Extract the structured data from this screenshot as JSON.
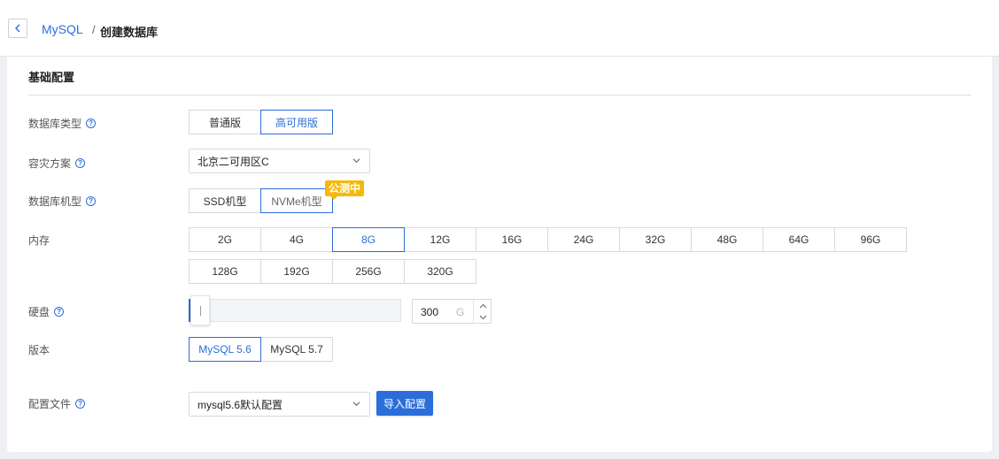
{
  "header": {
    "back_icon": "chevron-left-icon",
    "breadcrumb_link": "MySQL",
    "breadcrumb_separator": "/",
    "breadcrumb_current": "创建数据库"
  },
  "section": {
    "title": "基础配置"
  },
  "db_type": {
    "label": "数据库类型",
    "options": [
      "普通版",
      "高可用版"
    ],
    "selected": "高可用版"
  },
  "disaster_recovery": {
    "label": "容灾方案",
    "value": "北京二可用区C"
  },
  "machine_type": {
    "label": "数据库机型",
    "options": [
      "SSD机型",
      "NVMe机型"
    ],
    "selected": "SSD机型",
    "badge": "公测中"
  },
  "memory": {
    "label": "内存",
    "options_row1": [
      "2G",
      "4G",
      "8G",
      "12G",
      "16G",
      "24G",
      "32G",
      "48G",
      "64G",
      "96G"
    ],
    "options_row2": [
      "128G",
      "192G",
      "256G",
      "320G"
    ],
    "selected": "8G"
  },
  "disk": {
    "label": "硬盘",
    "value": "300",
    "unit": "G"
  },
  "version": {
    "label": "版本",
    "options": [
      "MySQL 5.6",
      "MySQL 5.7"
    ],
    "selected": "MySQL 5.6"
  },
  "config_file": {
    "label": "配置文件",
    "value": "mysql5.6默认配置",
    "import_button": "导入配置"
  },
  "help_icon_glyph": "?",
  "colors": {
    "accent": "#2b6ed9",
    "badge": "#f5b90a"
  }
}
